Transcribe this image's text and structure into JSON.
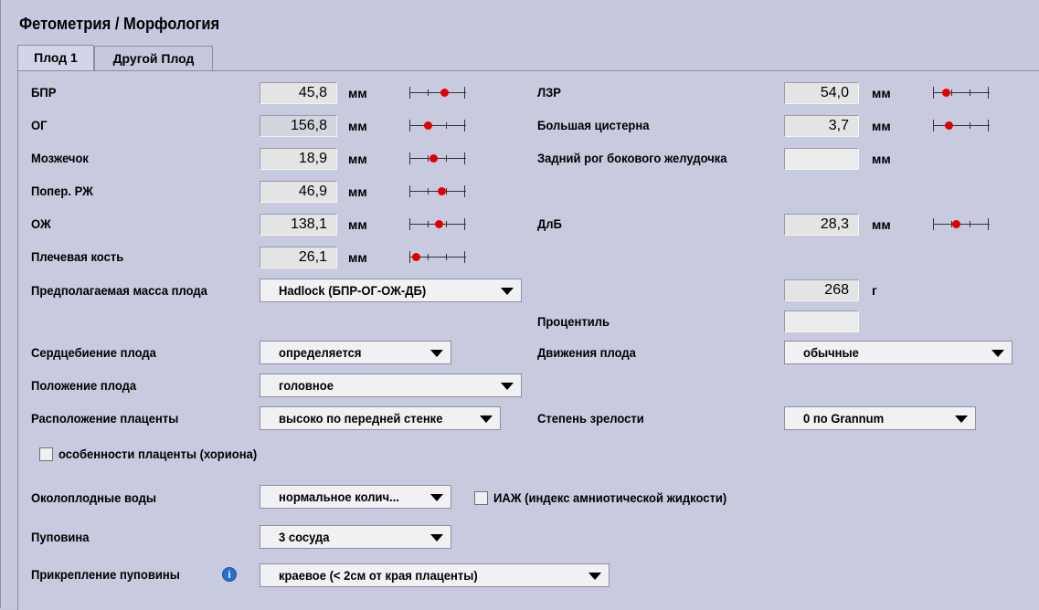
{
  "title": "Фетометрия / Морфология",
  "tabs": [
    {
      "label": "Плод 1"
    },
    {
      "label": "Другой Плод"
    }
  ],
  "measurements_left": [
    {
      "label": "БПР",
      "value": "45,8",
      "unit": "мм",
      "percent": 0.6
    },
    {
      "label": "ОГ",
      "value": "156,8",
      "unit": "мм",
      "percent": 0.3
    },
    {
      "label": "Мозжечок",
      "value": "18,9",
      "unit": "мм",
      "percent": 0.4
    },
    {
      "label": "Попер. РЖ",
      "value": "46,9",
      "unit": "мм",
      "percent": 0.55
    },
    {
      "label": "ОЖ",
      "value": "138,1",
      "unit": "мм",
      "percent": 0.5
    },
    {
      "label": "Плечевая кость",
      "value": "26,1",
      "unit": "мм",
      "percent": 0.08
    }
  ],
  "measurements_right": [
    {
      "label": "ЛЗР",
      "value": "54,0",
      "unit": "мм",
      "percent": 0.2
    },
    {
      "label": "Большая цистерна",
      "value": "3,7",
      "unit": "мм",
      "percent": 0.25
    },
    {
      "label": "Задний рог бокового желудочка",
      "value": "",
      "unit": "мм"
    },
    {
      "label": "ДлБ",
      "value": "28,3",
      "unit": "мм",
      "percent": 0.38
    }
  ],
  "mass": {
    "label": "Предполагаемая масса плода",
    "method": "Hadlock (БПР-ОГ-ОЖ-ДБ)",
    "value": "268",
    "unit": "г"
  },
  "percentile": {
    "label": "Процентиль",
    "value": ""
  },
  "heartbeat": {
    "label": "Сердцебиение плода",
    "value": "определяется"
  },
  "movements": {
    "label": "Движения плода",
    "value": "обычные"
  },
  "position": {
    "label": "Положение плода",
    "value": "головное"
  },
  "placenta_location": {
    "label": "Расположение плаценты",
    "value": "высоко по передней стенке"
  },
  "maturity": {
    "label": "Степень зрелости",
    "value": "0 по Grannum"
  },
  "placenta_features": {
    "label": "особенности плаценты (хориона)",
    "checked": false
  },
  "amniotic": {
    "label": "Околоплодные воды",
    "value": "нормальное колич..."
  },
  "afi": {
    "label": "ИАЖ (индекс амниотической жидкости)",
    "checked": false
  },
  "cord": {
    "label": "Пуповина",
    "value": "3 сосуда"
  },
  "cord_attachment": {
    "label": "Прикрепление пуповины",
    "value": "краевое (< 2см от края плаценты)",
    "icon": "info-icon"
  }
}
